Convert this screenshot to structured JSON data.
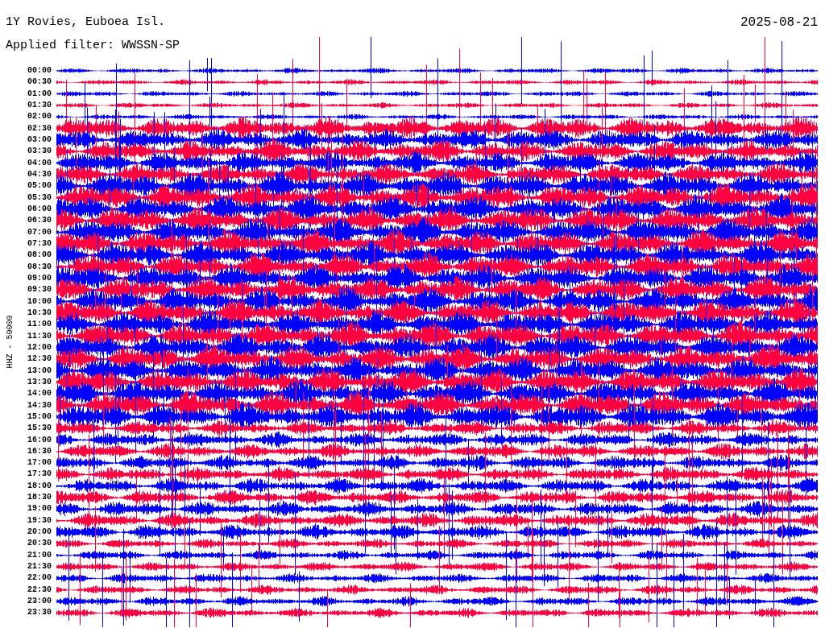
{
  "header": {
    "station": "1Y Rovies, Euboea Isl.",
    "date": "2025-08-21",
    "filter": "Applied filter: WWSSN-SP"
  },
  "channel_label": "HHZ - 50000",
  "rows": [
    {
      "time": "00:00"
    },
    {
      "time": "00:30"
    },
    {
      "time": "01:00"
    },
    {
      "time": "01:30"
    },
    {
      "time": "02:00"
    },
    {
      "time": "02:30"
    },
    {
      "time": "03:00"
    },
    {
      "time": "03:30"
    },
    {
      "time": "04:00"
    },
    {
      "time": "04:30"
    },
    {
      "time": "05:00"
    },
    {
      "time": "05:30"
    },
    {
      "time": "06:00"
    },
    {
      "time": "06:30"
    },
    {
      "time": "07:00"
    },
    {
      "time": "07:30"
    },
    {
      "time": "08:00"
    },
    {
      "time": "08:30"
    },
    {
      "time": "09:00"
    },
    {
      "time": "09:30"
    },
    {
      "time": "10:00"
    },
    {
      "time": "10:30"
    },
    {
      "time": "11:00"
    },
    {
      "time": "11:30"
    },
    {
      "time": "12:00"
    },
    {
      "time": "12:30"
    },
    {
      "time": "13:00"
    },
    {
      "time": "13:30"
    },
    {
      "time": "14:00"
    },
    {
      "time": "14:30"
    },
    {
      "time": "15:00"
    },
    {
      "time": "15:30"
    },
    {
      "time": "16:00"
    },
    {
      "time": "16:30"
    },
    {
      "time": "17:00"
    },
    {
      "time": "17:30"
    },
    {
      "time": "18:00"
    },
    {
      "time": "18:30"
    },
    {
      "time": "19:00"
    },
    {
      "time": "19:30"
    },
    {
      "time": "20:00"
    },
    {
      "time": "20:30"
    },
    {
      "time": "21:00"
    },
    {
      "time": "21:30"
    },
    {
      "time": "22:00"
    },
    {
      "time": "22:30"
    },
    {
      "time": "23:00"
    },
    {
      "time": "23:30"
    }
  ]
}
